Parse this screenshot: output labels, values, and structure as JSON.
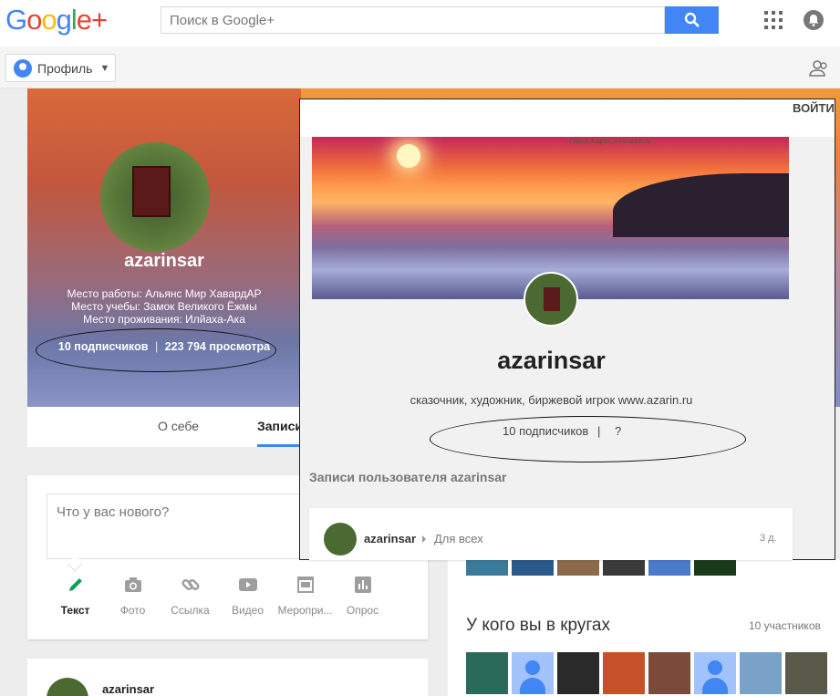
{
  "topbar": {
    "logo_word": "Google",
    "logo_plus": "+",
    "search_placeholder": "Поиск в Google+"
  },
  "subbar": {
    "profile_label": "Профиль"
  },
  "profile": {
    "name": "azarinsar",
    "work": "Место работы: Альянс Мир ХавардАР",
    "study": "Место учебы: Замок Великого Ёжмы",
    "residence": "Место проживания: Илйаха-Ака",
    "followers": "10 подписчиков",
    "separator": "|",
    "views": "223 794 просмотра"
  },
  "tabs": {
    "about": "О себе",
    "posts": "Записи"
  },
  "compose": {
    "placeholder": "Что у вас нового?",
    "tools": [
      {
        "label": "Текст",
        "icon": "pencil-icon",
        "color": "#0f9d58"
      },
      {
        "label": "Фото",
        "icon": "camera-icon",
        "color": "#9e9e9e"
      },
      {
        "label": "Ссылка",
        "icon": "link-icon",
        "color": "#9e9e9e"
      },
      {
        "label": "Видео",
        "icon": "video-icon",
        "color": "#9e9e9e"
      },
      {
        "label": "Меропри...",
        "icon": "event-icon",
        "color": "#9e9e9e"
      },
      {
        "label": "Опрос",
        "icon": "poll-icon",
        "color": "#9e9e9e"
      }
    ]
  },
  "post": {
    "author": "azarinsar"
  },
  "circles": {
    "title": "У кого вы в кругах",
    "count": "10 участников"
  },
  "overlay": {
    "login": "ВОЙТИ",
    "caption": "- Сергей Азарин, www.azarin.ru",
    "name": "azarinsar",
    "bio": "сказочник, художник, биржевой игрок www.azarin.ru",
    "followers": "10 подписчиков",
    "separator": "|",
    "views": "?",
    "section_title": "Записи пользователя azarinsar",
    "post_author": "azarinsar",
    "post_audience": "Для всех",
    "post_time": "3 д."
  },
  "colors": {
    "accent": "#4285f4",
    "brand_red": "#db4437"
  }
}
